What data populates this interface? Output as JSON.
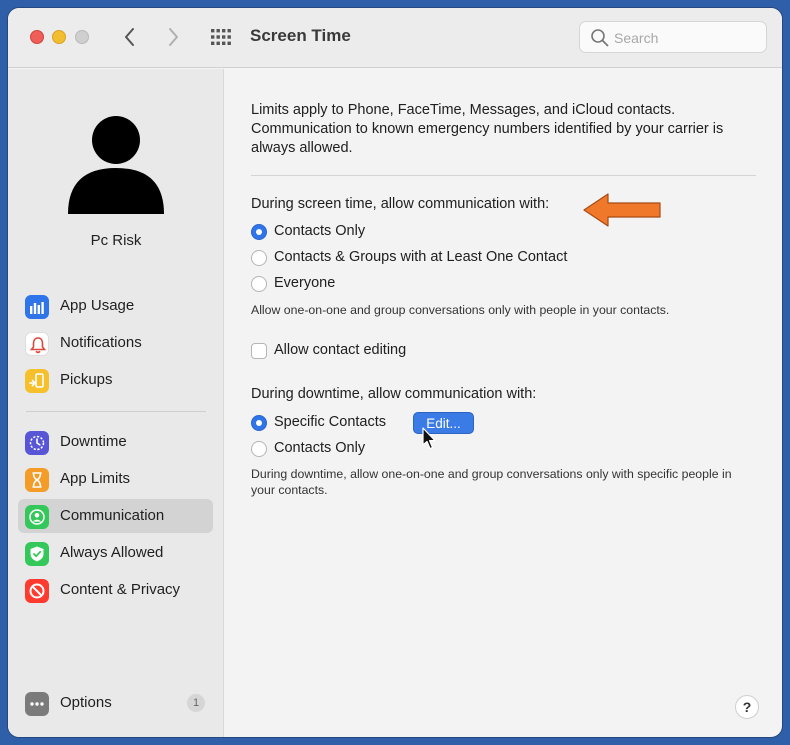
{
  "window": {
    "title": "Screen Time"
  },
  "search": {
    "placeholder": "Search"
  },
  "user": {
    "name": "Pc Risk"
  },
  "sidebar": {
    "group1": [
      {
        "label": "App Usage",
        "icon": "app-usage-icon"
      },
      {
        "label": "Notifications",
        "icon": "notifications-icon"
      },
      {
        "label": "Pickups",
        "icon": "pickups-icon"
      }
    ],
    "group2": [
      {
        "label": "Downtime",
        "icon": "downtime-icon"
      },
      {
        "label": "App Limits",
        "icon": "app-limits-icon"
      },
      {
        "label": "Communication",
        "icon": "communication-icon",
        "selected": true
      },
      {
        "label": "Always Allowed",
        "icon": "always-allowed-icon"
      },
      {
        "label": "Content & Privacy",
        "icon": "content-privacy-icon"
      }
    ],
    "options": {
      "label": "Options",
      "badge": "1"
    }
  },
  "main": {
    "intro": "Limits apply to Phone, FaceTime, Messages, and iCloud contacts. Communication to known emergency numbers identified by your carrier is always allowed.",
    "screen_time": {
      "heading": "During screen time, allow communication with:",
      "options": [
        "Contacts Only",
        "Contacts & Groups with at Least One Contact",
        "Everyone"
      ],
      "selected": "Contacts Only",
      "note": "Allow one-on-one and group conversations only with people in your contacts."
    },
    "contact_editing": {
      "label": "Allow contact editing",
      "checked": false
    },
    "downtime": {
      "heading": "During downtime, allow communication with:",
      "options": [
        "Specific Contacts",
        "Contacts Only"
      ],
      "selected": "Specific Contacts",
      "edit_label": "Edit...",
      "note": "During downtime, allow one-on-one and group conversations only with specific people in your contacts."
    },
    "help_label": "?"
  },
  "colors": {
    "accent": "#2f74e8",
    "annotation_arrow": "#f0782a",
    "sidebar_selected": "#d3d3d3"
  }
}
